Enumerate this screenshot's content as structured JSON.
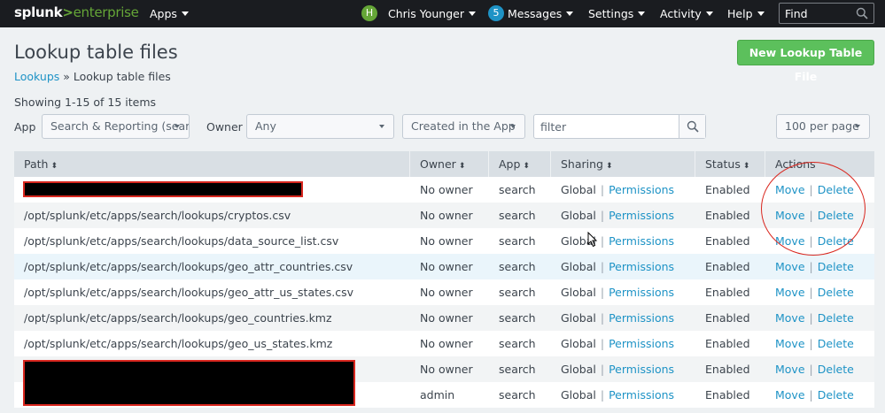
{
  "nav": {
    "logo_splunk": "splunk",
    "logo_gt": ">",
    "logo_enterprise": "enterprise",
    "apps": "Apps",
    "avatar_letter": "H",
    "user": "Chris Younger",
    "messages_count": "5",
    "messages": "Messages",
    "settings": "Settings",
    "activity": "Activity",
    "help": "Help",
    "find_placeholder": "Find"
  },
  "page": {
    "title": "Lookup table files",
    "breadcrumb_link": "Lookups",
    "breadcrumb_sep": " » ",
    "breadcrumb_current": "Lookup table files",
    "new_button": "New Lookup Table File",
    "showing": "Showing 1-15 of 15 items"
  },
  "filters": {
    "app_label": "App",
    "app_value": "Search & Reporting (search)",
    "owner_label": "Owner",
    "owner_value": "Any",
    "created_value": "Created in the App",
    "filter_placeholder": "filter",
    "per_page": "100 per page"
  },
  "table": {
    "headers": {
      "path": "Path",
      "owner": "Owner",
      "app": "App",
      "sharing": "Sharing",
      "status": "Status",
      "actions": "Actions"
    },
    "sort_glyph": "⬍",
    "rows": [
      {
        "path": "",
        "owner": "No owner",
        "app": "search",
        "sharing": "Global",
        "permissions": "Permissions",
        "status": "Enabled",
        "move": "Move",
        "delete": "Delete"
      },
      {
        "path": "/opt/splunk/etc/apps/search/lookups/cryptos.csv",
        "owner": "No owner",
        "app": "search",
        "sharing": "Global",
        "permissions": "Permissions",
        "status": "Enabled",
        "move": "Move",
        "delete": "Delete"
      },
      {
        "path": "/opt/splunk/etc/apps/search/lookups/data_source_list.csv",
        "owner": "No owner",
        "app": "search",
        "sharing": "Global",
        "permissions": "Permissions",
        "status": "Enabled",
        "move": "Move",
        "delete": "Delete"
      },
      {
        "path": "/opt/splunk/etc/apps/search/lookups/geo_attr_countries.csv",
        "owner": "No owner",
        "app": "search",
        "sharing": "Global",
        "permissions": "Permissions",
        "status": "Enabled",
        "move": "Move",
        "delete": "Delete"
      },
      {
        "path": "/opt/splunk/etc/apps/search/lookups/geo_attr_us_states.csv",
        "owner": "No owner",
        "app": "search",
        "sharing": "Global",
        "permissions": "Permissions",
        "status": "Enabled",
        "move": "Move",
        "delete": "Delete"
      },
      {
        "path": "/opt/splunk/etc/apps/search/lookups/geo_countries.kmz",
        "owner": "No owner",
        "app": "search",
        "sharing": "Global",
        "permissions": "Permissions",
        "status": "Enabled",
        "move": "Move",
        "delete": "Delete"
      },
      {
        "path": "/opt/splunk/etc/apps/search/lookups/geo_us_states.kmz",
        "owner": "No owner",
        "app": "search",
        "sharing": "Global",
        "permissions": "Permissions",
        "status": "Enabled",
        "move": "Move",
        "delete": "Delete"
      },
      {
        "path": "",
        "owner": "No owner",
        "app": "search",
        "sharing": "Global",
        "permissions": "Permissions",
        "status": "Enabled",
        "move": "Move",
        "delete": "Delete"
      },
      {
        "path": "",
        "owner": "admin",
        "app": "search",
        "sharing": "Global",
        "permissions": "Permissions",
        "status": "Enabled",
        "move": "Move",
        "delete": "Delete"
      }
    ]
  }
}
